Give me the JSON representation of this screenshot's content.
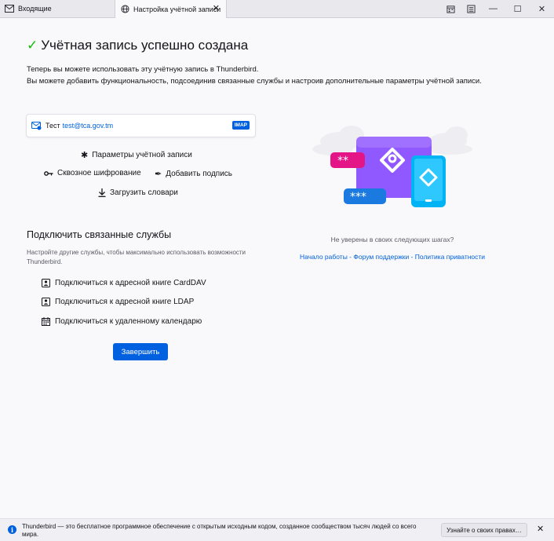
{
  "tabs": [
    {
      "label": "Входящие",
      "icon": "envelope-icon"
    },
    {
      "label": "Настройка учётной записи",
      "icon": "globe-icon",
      "close": "✕"
    }
  ],
  "window_controls": {
    "minimize": "—",
    "maximize": "☐",
    "close": "✕"
  },
  "page": {
    "check": "✓",
    "title": "Учётная запись успешно создана",
    "intro_line1": "Теперь вы можете использовать эту учётную запись в Thunderbird.",
    "intro_line2": "Вы можете добавить функциональность, подсоединив связанные службы и настроив дополнительные параметры учётной записи."
  },
  "account": {
    "name": "Тест",
    "email": "test@tca.gov.tm",
    "badge": "IMAP"
  },
  "actions": {
    "settings": "Параметры учётной записи",
    "e2e": "Сквозное шифрование",
    "signature": "Добавить подпись",
    "dictionaries": "Загрузить словари"
  },
  "services": {
    "title": "Подключить связанные службы",
    "description": "Настройте другие службы, чтобы максимально использовать возможности Thunderbird.",
    "carddav": "Подключиться к адресной книге CardDAV",
    "ldap": "Подключиться к адресной книге LDAP",
    "calendar": "Подключиться к удаленному календарю"
  },
  "finish_label": "Завершить",
  "help": {
    "question": "Не уверены в своих следующих шагах?",
    "links": [
      "Начало работы",
      "Форум поддержки",
      "Политика приватности"
    ],
    "separator": " - "
  },
  "notification": {
    "message": "Thunderbird — это бесплатное программное обеспечение с открытым исходным кодом, созданное сообществом тысяч людей со всего мира.",
    "button": "Узнайте о своих правах…",
    "close": "✕"
  },
  "colors": {
    "accent": "#0061e0",
    "success": "#12bc00",
    "illustration_purple": "#9059ff",
    "illustration_blue": "#00b3f4",
    "illustration_pink": "#e31587"
  }
}
